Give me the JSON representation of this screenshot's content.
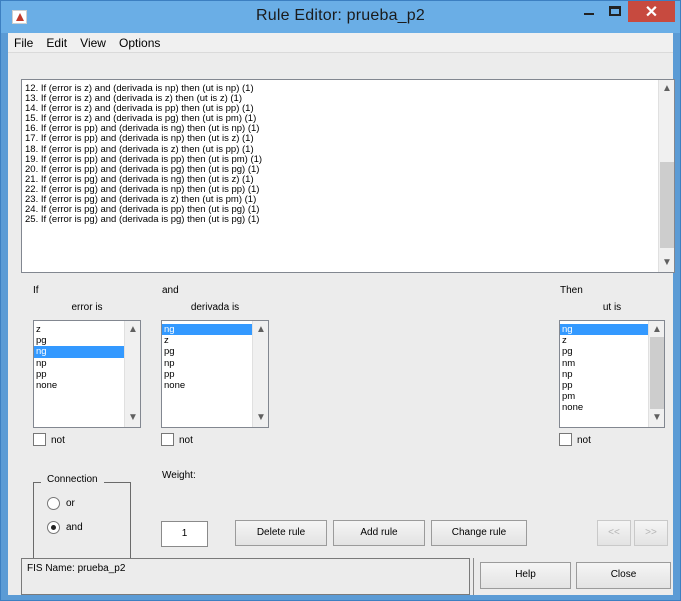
{
  "window": {
    "title": "Rule Editor: prueba_p2",
    "close_glyph": "✕"
  },
  "menu": {
    "items": [
      "File",
      "Edit",
      "View",
      "Options"
    ]
  },
  "rules": [
    "12. If (error is z) and (derivada is np) then (ut is np) (1)",
    "13. If (error is z) and (derivada is z) then (ut is z) (1)",
    "14. If (error is z) and (derivada is pp) then (ut is pp) (1)",
    "15. If (error is z) and (derivada is pg) then (ut is pm) (1)",
    "16. If (error is pp) and (derivada is ng) then (ut is np) (1)",
    "17. If (error is pp) and (derivada is np) then (ut is z) (1)",
    "18. If (error is pp) and (derivada is z) then (ut is pp) (1)",
    "19. If (error is pp) and (derivada is pp) then (ut is pm) (1)",
    "20. If (error is pp) and (derivada is pg) then (ut is pg) (1)",
    "21. If (error is pg) and (derivada is ng) then (ut is z) (1)",
    "22. If (error is pg) and (derivada is np) then (ut is pp) (1)",
    "23. If (error is pg) and (derivada is z) then (ut is pm) (1)",
    "24. If (error is pg) and (derivada is pp) then (ut is pg) (1)",
    "25. If (error is pg) and (derivada is pg) then (ut is pg) (1)"
  ],
  "antecedent": {
    "if_label": "If",
    "and_label": "and",
    "error": {
      "heading": "error is",
      "options": [
        "z",
        "pg",
        "ng",
        "np",
        "pp",
        "none"
      ],
      "selected": "ng"
    },
    "derivada": {
      "heading": "derivada is",
      "options": [
        "ng",
        "z",
        "pg",
        "np",
        "pp",
        "none"
      ],
      "selected": "ng"
    }
  },
  "consequent": {
    "then_label": "Then",
    "ut": {
      "heading": "ut is",
      "options": [
        "ng",
        "z",
        "pg",
        "nm",
        "np",
        "pp",
        "pm",
        "none"
      ],
      "selected": "ng"
    }
  },
  "not_label": "not",
  "connection": {
    "title": "Connection",
    "options": [
      "or",
      "and"
    ],
    "selected": "and"
  },
  "weight": {
    "label": "Weight:",
    "value": "1"
  },
  "buttons": {
    "delete_rule": "Delete rule",
    "add_rule": "Add rule",
    "change_rule": "Change rule",
    "prev": "<<",
    "next": ">>",
    "help": "Help",
    "close": "Close"
  },
  "status": {
    "fis_name": "FIS Name: prueba_p2"
  },
  "colors": {
    "selection": "#3399ff",
    "titlebar": "#6aaee6",
    "close": "#c74a3f"
  }
}
